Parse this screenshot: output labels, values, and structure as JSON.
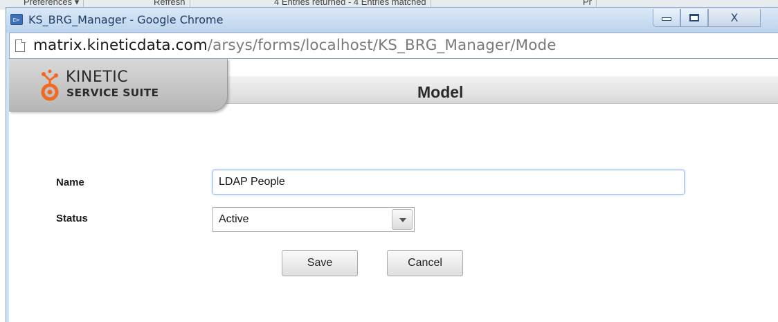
{
  "background_app": {
    "toolbar_items": [
      "Preferences ▾",
      "Refresh",
      "4 Entries returned - 4 Entries matched",
      "Pr"
    ]
  },
  "window": {
    "title": "KS_BRG_Manager - Google Chrome",
    "close_glyph": "X"
  },
  "url_bar": {
    "host": "matrix.kineticdata.com",
    "path": "/arsys/forms/localhost/KS_BRG_Manager/Mode"
  },
  "header": {
    "logo_line1": "KINETIC",
    "logo_line2": "SERVICE SUITE",
    "page_title": "Model"
  },
  "form": {
    "name_label": "Name",
    "name_value": "LDAP People",
    "status_label": "Status",
    "status_value": "Active",
    "save_label": "Save",
    "cancel_label": "Cancel"
  },
  "colors": {
    "titlebar": "#c9dcf0",
    "logo_accent": "#f26a21"
  }
}
